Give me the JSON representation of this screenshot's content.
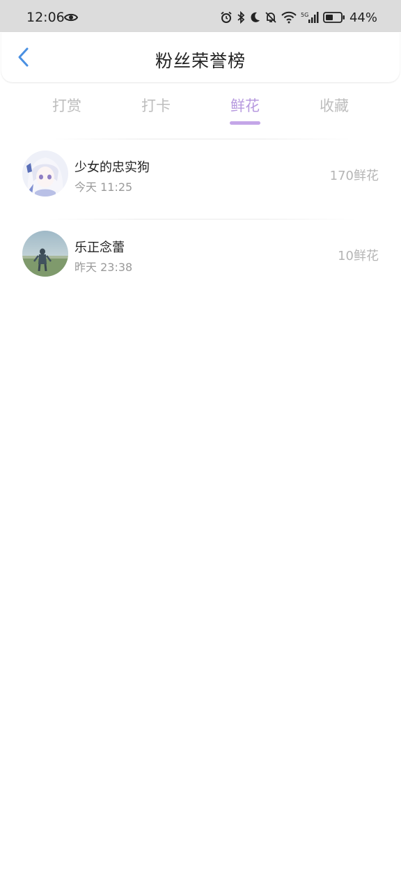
{
  "status_bar": {
    "time": "12:06",
    "battery": "44%",
    "network": "5G"
  },
  "header": {
    "title": "粉丝荣誉榜"
  },
  "tabs": [
    {
      "label": "打赏",
      "active": false
    },
    {
      "label": "打卡",
      "active": false
    },
    {
      "label": "鲜花",
      "active": true
    },
    {
      "label": "收藏",
      "active": false
    }
  ],
  "accent_color": "#b79adf",
  "rows": [
    {
      "name": "少女的忠实狗",
      "time": "今天 11:25",
      "amount": "170鲜花"
    },
    {
      "name": "乐正念蕾",
      "time": "昨天 23:38",
      "amount": "10鲜花"
    }
  ]
}
